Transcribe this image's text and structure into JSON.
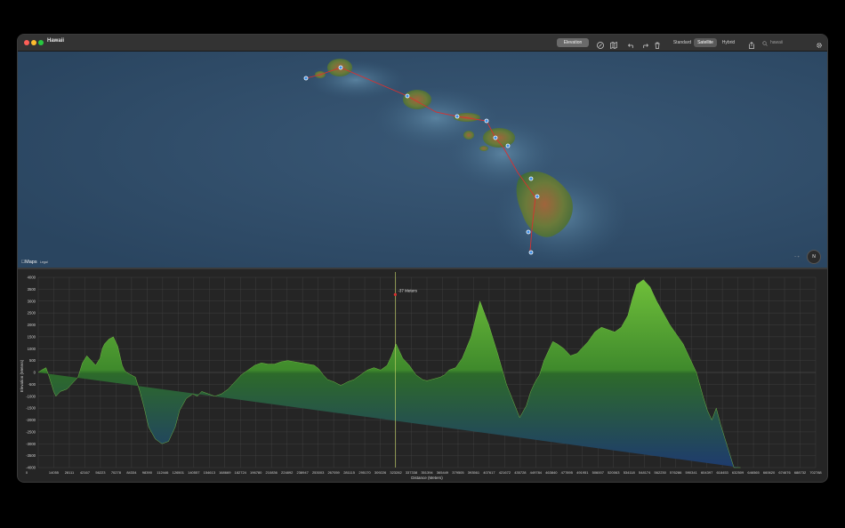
{
  "window": {
    "title": "Hawaii"
  },
  "toolbar": {
    "elevation_label": "Elevation",
    "map_modes": [
      "Standard",
      "Satellite",
      "Hybrid"
    ],
    "active_mode": "Satellite",
    "search_value": "hawaii",
    "icons": [
      "location-icon",
      "map-icon",
      "undo-icon",
      "redo-icon",
      "trash-icon",
      "share-icon",
      "search-icon",
      "gear-icon"
    ]
  },
  "map": {
    "brand": "Maps",
    "legal": "Legal",
    "compass_label": "N",
    "zoom_label": "− +",
    "route_color": "#d9302f",
    "waypoint_color": "#3c8ee6"
  },
  "chart_data": {
    "type": "area",
    "ylabel": "Elevation (Meters)",
    "xlabel": "Distance (Meters)",
    "ylim": [
      -4000,
      4000
    ],
    "yticks": [
      4000,
      3500,
      3000,
      2500,
      2000,
      1500,
      1000,
      500,
      0,
      -500,
      -1000,
      -1500,
      -2000,
      -2500,
      -3000,
      -3500,
      -4000
    ],
    "xticks": [
      "0",
      "14055",
      "28111",
      "42167",
      "56223",
      "70278",
      "84334",
      "98390",
      "112446",
      "126501",
      "140557",
      "154613",
      "168669",
      "182724",
      "196780",
      "210836",
      "224892",
      "238947",
      "253003",
      "267059",
      "281115",
      "295170",
      "309226",
      "323282",
      "337338",
      "351394",
      "365449",
      "379505",
      "393561",
      "407617",
      "421672",
      "435728",
      "449784",
      "463840",
      "477895",
      "491951",
      "506007",
      "520063",
      "534118",
      "548174",
      "562230",
      "576286",
      "590341",
      "604397",
      "618453",
      "632509",
      "646565",
      "660620",
      "674676",
      "688732",
      "702788"
    ],
    "cursor": {
      "x": 323282,
      "label": "-37 Meters"
    },
    "x": [
      0,
      3000,
      7000,
      10000,
      12000,
      14000,
      16000,
      20000,
      26000,
      30000,
      36000,
      40000,
      44000,
      48000,
      52000,
      56000,
      58000,
      60000,
      64000,
      68000,
      72000,
      76000,
      78000,
      80000,
      84000,
      88000,
      92000,
      96000,
      100000,
      106000,
      112000,
      118000,
      124000,
      128000,
      134000,
      140000,
      144000,
      148000,
      154000,
      160000,
      166000,
      172000,
      178000,
      184000,
      190000,
      196000,
      202000,
      208000,
      214000,
      220000,
      226000,
      232000,
      238000,
      244000,
      250000,
      254000,
      258000,
      262000,
      268000,
      274000,
      280000,
      286000,
      292000,
      298000,
      304000,
      310000,
      316000,
      320000,
      324000,
      330000,
      336000,
      342000,
      348000,
      352000,
      356000,
      360000,
      364000,
      368000,
      372000,
      378000,
      384000,
      392000,
      400000,
      408000,
      416000,
      424000,
      430000,
      436000,
      442000,
      446000,
      450000,
      454000,
      456000,
      458000,
      462000,
      466000,
      470000,
      476000,
      482000,
      488000,
      492000,
      498000,
      504000,
      510000,
      516000,
      522000,
      528000,
      534000,
      538000,
      542000,
      548000,
      554000,
      560000,
      566000,
      572000,
      578000,
      584000,
      590000,
      596000,
      602000,
      606000,
      610000,
      614000,
      618000,
      624000,
      630000,
      636000,
      642000,
      648000,
      654000,
      658000,
      662000,
      666000,
      670000,
      676000,
      682000,
      686000,
      690000,
      694000,
      698000,
      702000,
      704000
    ],
    "y": [
      0,
      100,
      200,
      -200,
      -500,
      -800,
      -1000,
      -800,
      -700,
      -500,
      -200,
      400,
      700,
      500,
      300,
      600,
      1000,
      1200,
      1400,
      1500,
      1100,
      300,
      100,
      0,
      -100,
      -200,
      -800,
      -1500,
      -2300,
      -2800,
      -3000,
      -2900,
      -2300,
      -1600,
      -1100,
      -900,
      -1000,
      -800,
      -900,
      -1000,
      -900,
      -700,
      -400,
      -100,
      100,
      300,
      400,
      350,
      350,
      450,
      500,
      450,
      400,
      350,
      300,
      150,
      -100,
      -300,
      -400,
      -550,
      -400,
      -300,
      -100,
      100,
      200,
      100,
      300,
      700,
      1200,
      600,
      300,
      -100,
      -300,
      -350,
      -300,
      -250,
      -200,
      -100,
      100,
      200,
      600,
      1500,
      3000,
      2000,
      800,
      -500,
      -1200,
      -1900,
      -1400,
      -800,
      -400,
      -100,
      200,
      500,
      900,
      1300,
      1200,
      1000,
      700,
      800,
      1000,
      1300,
      1700,
      1900,
      1800,
      1700,
      1900,
      2400,
      3100,
      3700,
      3900,
      3600,
      3000,
      2500,
      2000,
      1600,
      1200,
      600,
      0,
      -1000,
      -1600,
      -2000,
      -1500,
      -2200,
      -3100,
      -4000,
      -4000
    ],
    "grid": true,
    "fill_top_color": "#6fbf3a",
    "fill_bottom_color": "#1e3b6e"
  }
}
